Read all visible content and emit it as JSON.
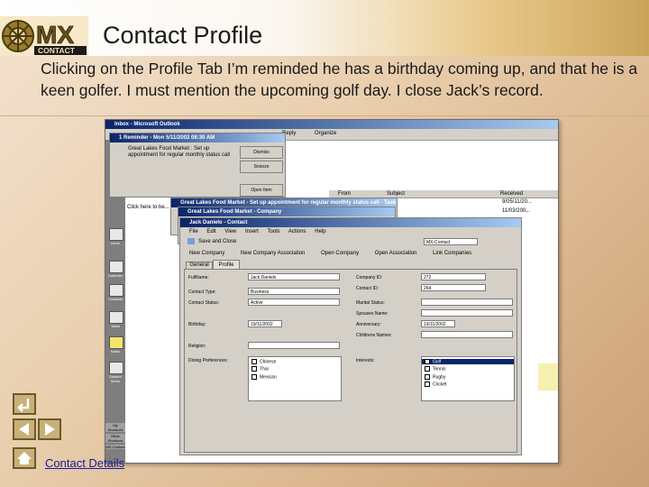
{
  "slide": {
    "title": "Contact Profile",
    "description": "Clicking on the Profile Tab I’m reminded he has a birthday coming up, and that he is a keen golfer. I must mention the upcoming golf day. I close Jack’s record.",
    "logo_text_top": "MX",
    "logo_text_bottom": "CONTACT",
    "footer_link": "Contact Details"
  },
  "outlook": {
    "title": "Inbox - Microsoft Outlook",
    "side_items": [
      "Inbox",
      "Calendar",
      "Contacts",
      "Tasks",
      "Notes",
      "Deleted Items"
    ],
    "shortcuts": [
      "My Shortcuts",
      "Other Shortcuts",
      "MX-Contact"
    ],
    "list_headers": {
      "from": "From",
      "subject": "Subject",
      "received": "Received"
    },
    "received": [
      "9/05/11/20...",
      "11/03/200..."
    ],
    "inline_text": "Click here to be...",
    "toolbar": {
      "reply": "Reply",
      "organize": "Organize"
    }
  },
  "reminder": {
    "title": "1 Reminder - Mon 5/11/2002 08:30 AM",
    "text": "Great Lakes Food Market : Set up appointment for regular monthly status call",
    "dismiss": "Dismiss",
    "snooze": "Snooze",
    "open_item": "Open Item"
  },
  "task": {
    "title": "Great Lakes Food Market - Set up appointment for regular monthly status call - Task"
  },
  "company": {
    "title": "Great Lakes Food Market - Company"
  },
  "contact": {
    "title": "Jack Danielo - Contact",
    "menu": [
      "File",
      "Edit",
      "View",
      "Insert",
      "Tools",
      "Actions",
      "Help"
    ],
    "toolbar": {
      "save_close": "Save and Close",
      "mx_contact": "MX-Contact"
    },
    "toolbar2": [
      "New Company",
      "New Company Association",
      "Open Company",
      "Open Association",
      "Link Companies"
    ],
    "tabs": [
      "General",
      "Profile"
    ],
    "fields": {
      "fullname_label": "FullName:",
      "fullname": "Jack Daniels",
      "contact_type_label": "Contact Type:",
      "contact_type": "Business",
      "contact_status_label": "Contact Status:",
      "contact_status": "Active",
      "birthday_label": "Birthday:",
      "birthday": "19/11/2002",
      "religion_label": "Religion:",
      "dining_label": "Dining Preferences:",
      "dining": [
        "Chinese",
        "Thai",
        "Mexican"
      ],
      "company_id_label": "Company ID:",
      "company_id": "272",
      "contact_id_label": "Contact ID:",
      "contact_id": "264",
      "marital_label": "Marital Status:",
      "spouse_label": "Spouses Name:",
      "anniversary_label": "Anniversary:",
      "anniversary": "19/11/2002",
      "children_label": "Childrens Names:",
      "interests_label": "Interests:",
      "interests": [
        "Golf",
        "Tennis",
        "Rugby",
        "Cricket"
      ]
    }
  }
}
